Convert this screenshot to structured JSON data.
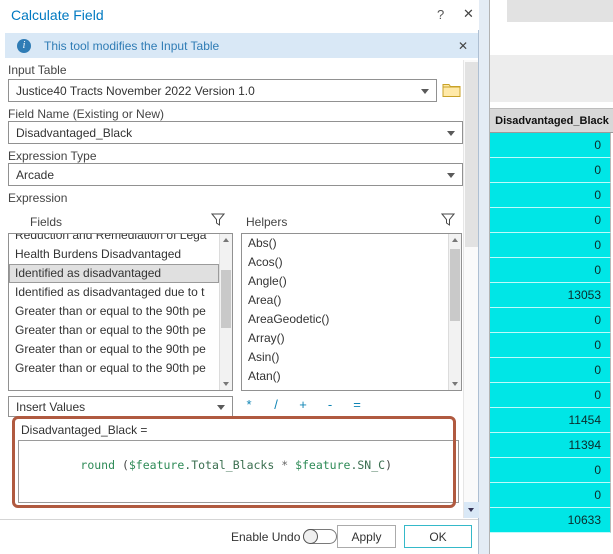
{
  "background": {
    "fragment": "m"
  },
  "window": {
    "title": "Calculate Field",
    "help_glyph": "?",
    "close_glyph": "✕"
  },
  "banner": {
    "info_glyph": "i",
    "text": "This tool modifies the Input Table",
    "close_glyph": "✕"
  },
  "form": {
    "input_table": {
      "label": "Input Table",
      "value": "Justice40 Tracts November 2022 Version 1.0"
    },
    "field_name": {
      "label": "Field Name (Existing or New)",
      "value": "Disadvantaged_Black"
    },
    "expression_type": {
      "label": "Expression Type",
      "value": "Arcade"
    },
    "expression_label": "Expression"
  },
  "fields_panel": {
    "label": "Fields",
    "selected_index": 2,
    "items": [
      "Reduction and Remediation of Lega",
      "Health Burdens Disadvantaged",
      "Identified as disadvantaged",
      "Identified as disadvantaged due to t",
      "Greater than or equal to the 90th pe",
      "Greater than or equal to the 90th pe",
      "Greater than or equal to the 90th pe",
      "Greater than or equal to the 90th pe"
    ]
  },
  "helpers_panel": {
    "label": "Helpers",
    "items": [
      "Abs()",
      "Acos()",
      "Angle()",
      "Area()",
      "AreaGeodetic()",
      "Array()",
      "Asin()",
      "Atan()"
    ]
  },
  "insert_values": {
    "label": "Insert Values",
    "operators": [
      "*",
      "/",
      "+",
      "-",
      "="
    ]
  },
  "expression": {
    "assignment_label": "Disadvantaged_Black =",
    "code_text": "round ($feature.Total_Blacks * $feature.SN_C)",
    "tokens": [
      {
        "text": "round ",
        "color": "#2e8b57"
      },
      {
        "text": "(",
        "color": "#444444"
      },
      {
        "text": "$feature",
        "color": "#2e8b57"
      },
      {
        "text": ".Total_Blacks",
        "color": "#3a6e4f"
      },
      {
        "text": " * ",
        "color": "#666666"
      },
      {
        "text": "$feature",
        "color": "#2e8b57"
      },
      {
        "text": ".SN_C",
        "color": "#3a6e4f"
      },
      {
        "text": ")",
        "color": "#444444"
      }
    ]
  },
  "footer": {
    "enable_undo_label": "Enable Undo",
    "apply_label": "Apply",
    "ok_label": "OK"
  },
  "attribute_table": {
    "header": "Disadvantaged_Black",
    "values": [
      "0",
      "0",
      "0",
      "0",
      "0",
      "0",
      "13053",
      "0",
      "0",
      "0",
      "0",
      "11454",
      "11394",
      "0",
      "0",
      "10633"
    ]
  },
  "colors": {
    "accent": "#0079c1",
    "banner_bg": "#d9e8f6",
    "highlight_cell": "#00e6e6",
    "annotation_box": "#b05a40",
    "ok_button_border": "#35b9c9"
  }
}
